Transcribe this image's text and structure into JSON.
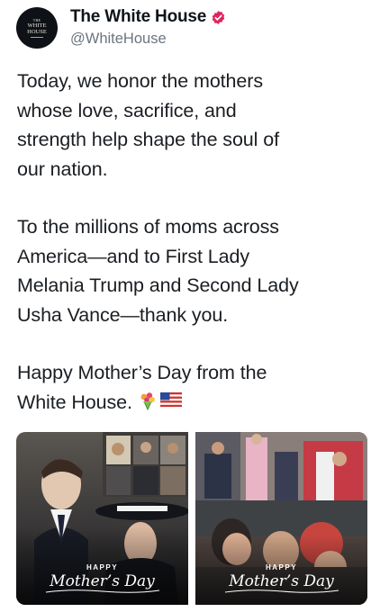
{
  "account": {
    "avatar_lines": [
      "THE",
      "WHITE",
      "HOUSE"
    ],
    "name": "The White House",
    "handle": "@WhiteHouse",
    "verified_color": "#e0245e"
  },
  "tweet": {
    "paragraphs": [
      "Today, we honor the mothers\nwhose love, sacrifice, and\nstrength help shape the soul of\nour nation.",
      "To the millions of moms across\nAmerica—and to First Lady\nMelania Trump and Second Lady\nUsha Vance—thank you.",
      "Happy Mother’s Day from the\nWhite House."
    ],
    "emojis": [
      "bouquet-icon",
      "us-flag-icon"
    ]
  },
  "media": [
    {
      "happy": "HAPPY",
      "title": "Mother’s Day"
    },
    {
      "happy": "HAPPY",
      "title": "Mother’s Day"
    }
  ]
}
